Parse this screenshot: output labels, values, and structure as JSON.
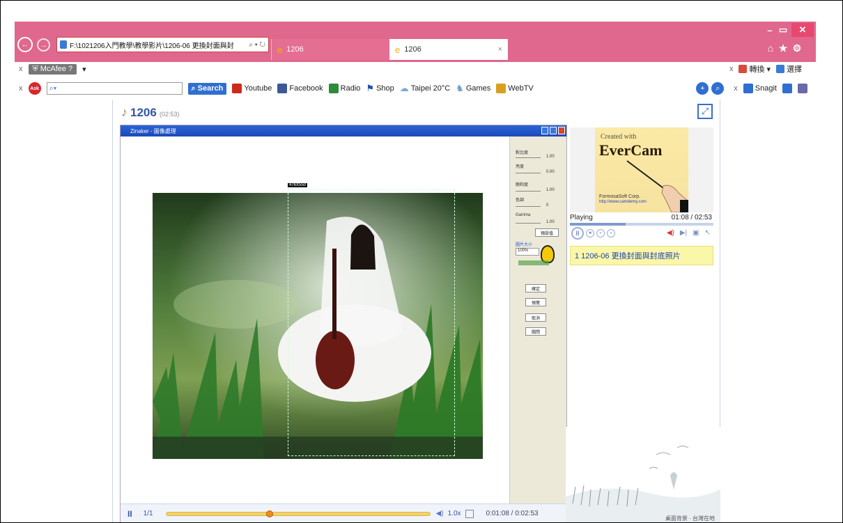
{
  "browser": {
    "address": "F:\\1021206入門教學\\教學影片\\1206-06 更換封面與封",
    "address_controls": "⌕ ▾ ↻",
    "tabs": [
      {
        "label": "1206",
        "active": false
      },
      {
        "label": "1206",
        "active": true
      }
    ],
    "window_controls": [
      "–",
      "▭",
      "✕"
    ],
    "right_icons": [
      "⌂",
      "★",
      "⚙"
    ]
  },
  "toolbar1": {
    "close": "x",
    "mcafee": "McAfee",
    "mcafee_extra": "▾",
    "close_right": "x",
    "convert": "轉換",
    "select": "選擇"
  },
  "toolbar2": {
    "close": "x",
    "ask_logo": "Ask",
    "search_placeholder": "",
    "search_button": "Search",
    "links": [
      {
        "label": "Youtube",
        "color": "#cc2a1a"
      },
      {
        "label": "Facebook",
        "color": "#3b5998"
      },
      {
        "label": "Radio",
        "color": "#2e8b3c"
      },
      {
        "label": "Shop",
        "color": "#1b4fb5"
      },
      {
        "label": "Taipei 20°C",
        "color": "#7aa7d9"
      },
      {
        "label": "Games",
        "color": "#6a9bd0"
      },
      {
        "label": "WebTV",
        "color": "#d9a020"
      }
    ],
    "close_right": "x",
    "snagit": "Snagit"
  },
  "player": {
    "title": "1206",
    "duration": "(02:53)",
    "video_window_title": "Zinaker - 圖像處理",
    "selection_size": "476X550",
    "side_labels": [
      "對比度",
      "亮度",
      "飽和度",
      "色調",
      "Gamma"
    ],
    "side_values": [
      "1.00",
      "0.00",
      "1.00",
      "0",
      "1.00"
    ],
    "reset_label": "預設值",
    "size_label": "圖片大小",
    "size_value": "100%",
    "side_buttons": [
      "確定",
      "預覽",
      "取消",
      "關閉"
    ],
    "controls": {
      "pause": "II",
      "page": "1/1",
      "progress": 0.38,
      "speed": "1.0x",
      "time": "0:01:08 / 0:02:53"
    }
  },
  "sidebar": {
    "evercam_created": "Created with",
    "evercam_name": "EverCam",
    "evercam_company": "FormosaSoft Corp.",
    "evercam_url": "http://www.camdemy.com",
    "status": "Playing",
    "time": "01:08 / 02:53",
    "position": 0.39,
    "chapter": "1  1206-06 更換封面與封底照片",
    "footer_text": "桌面背景 · 台灣在地"
  }
}
